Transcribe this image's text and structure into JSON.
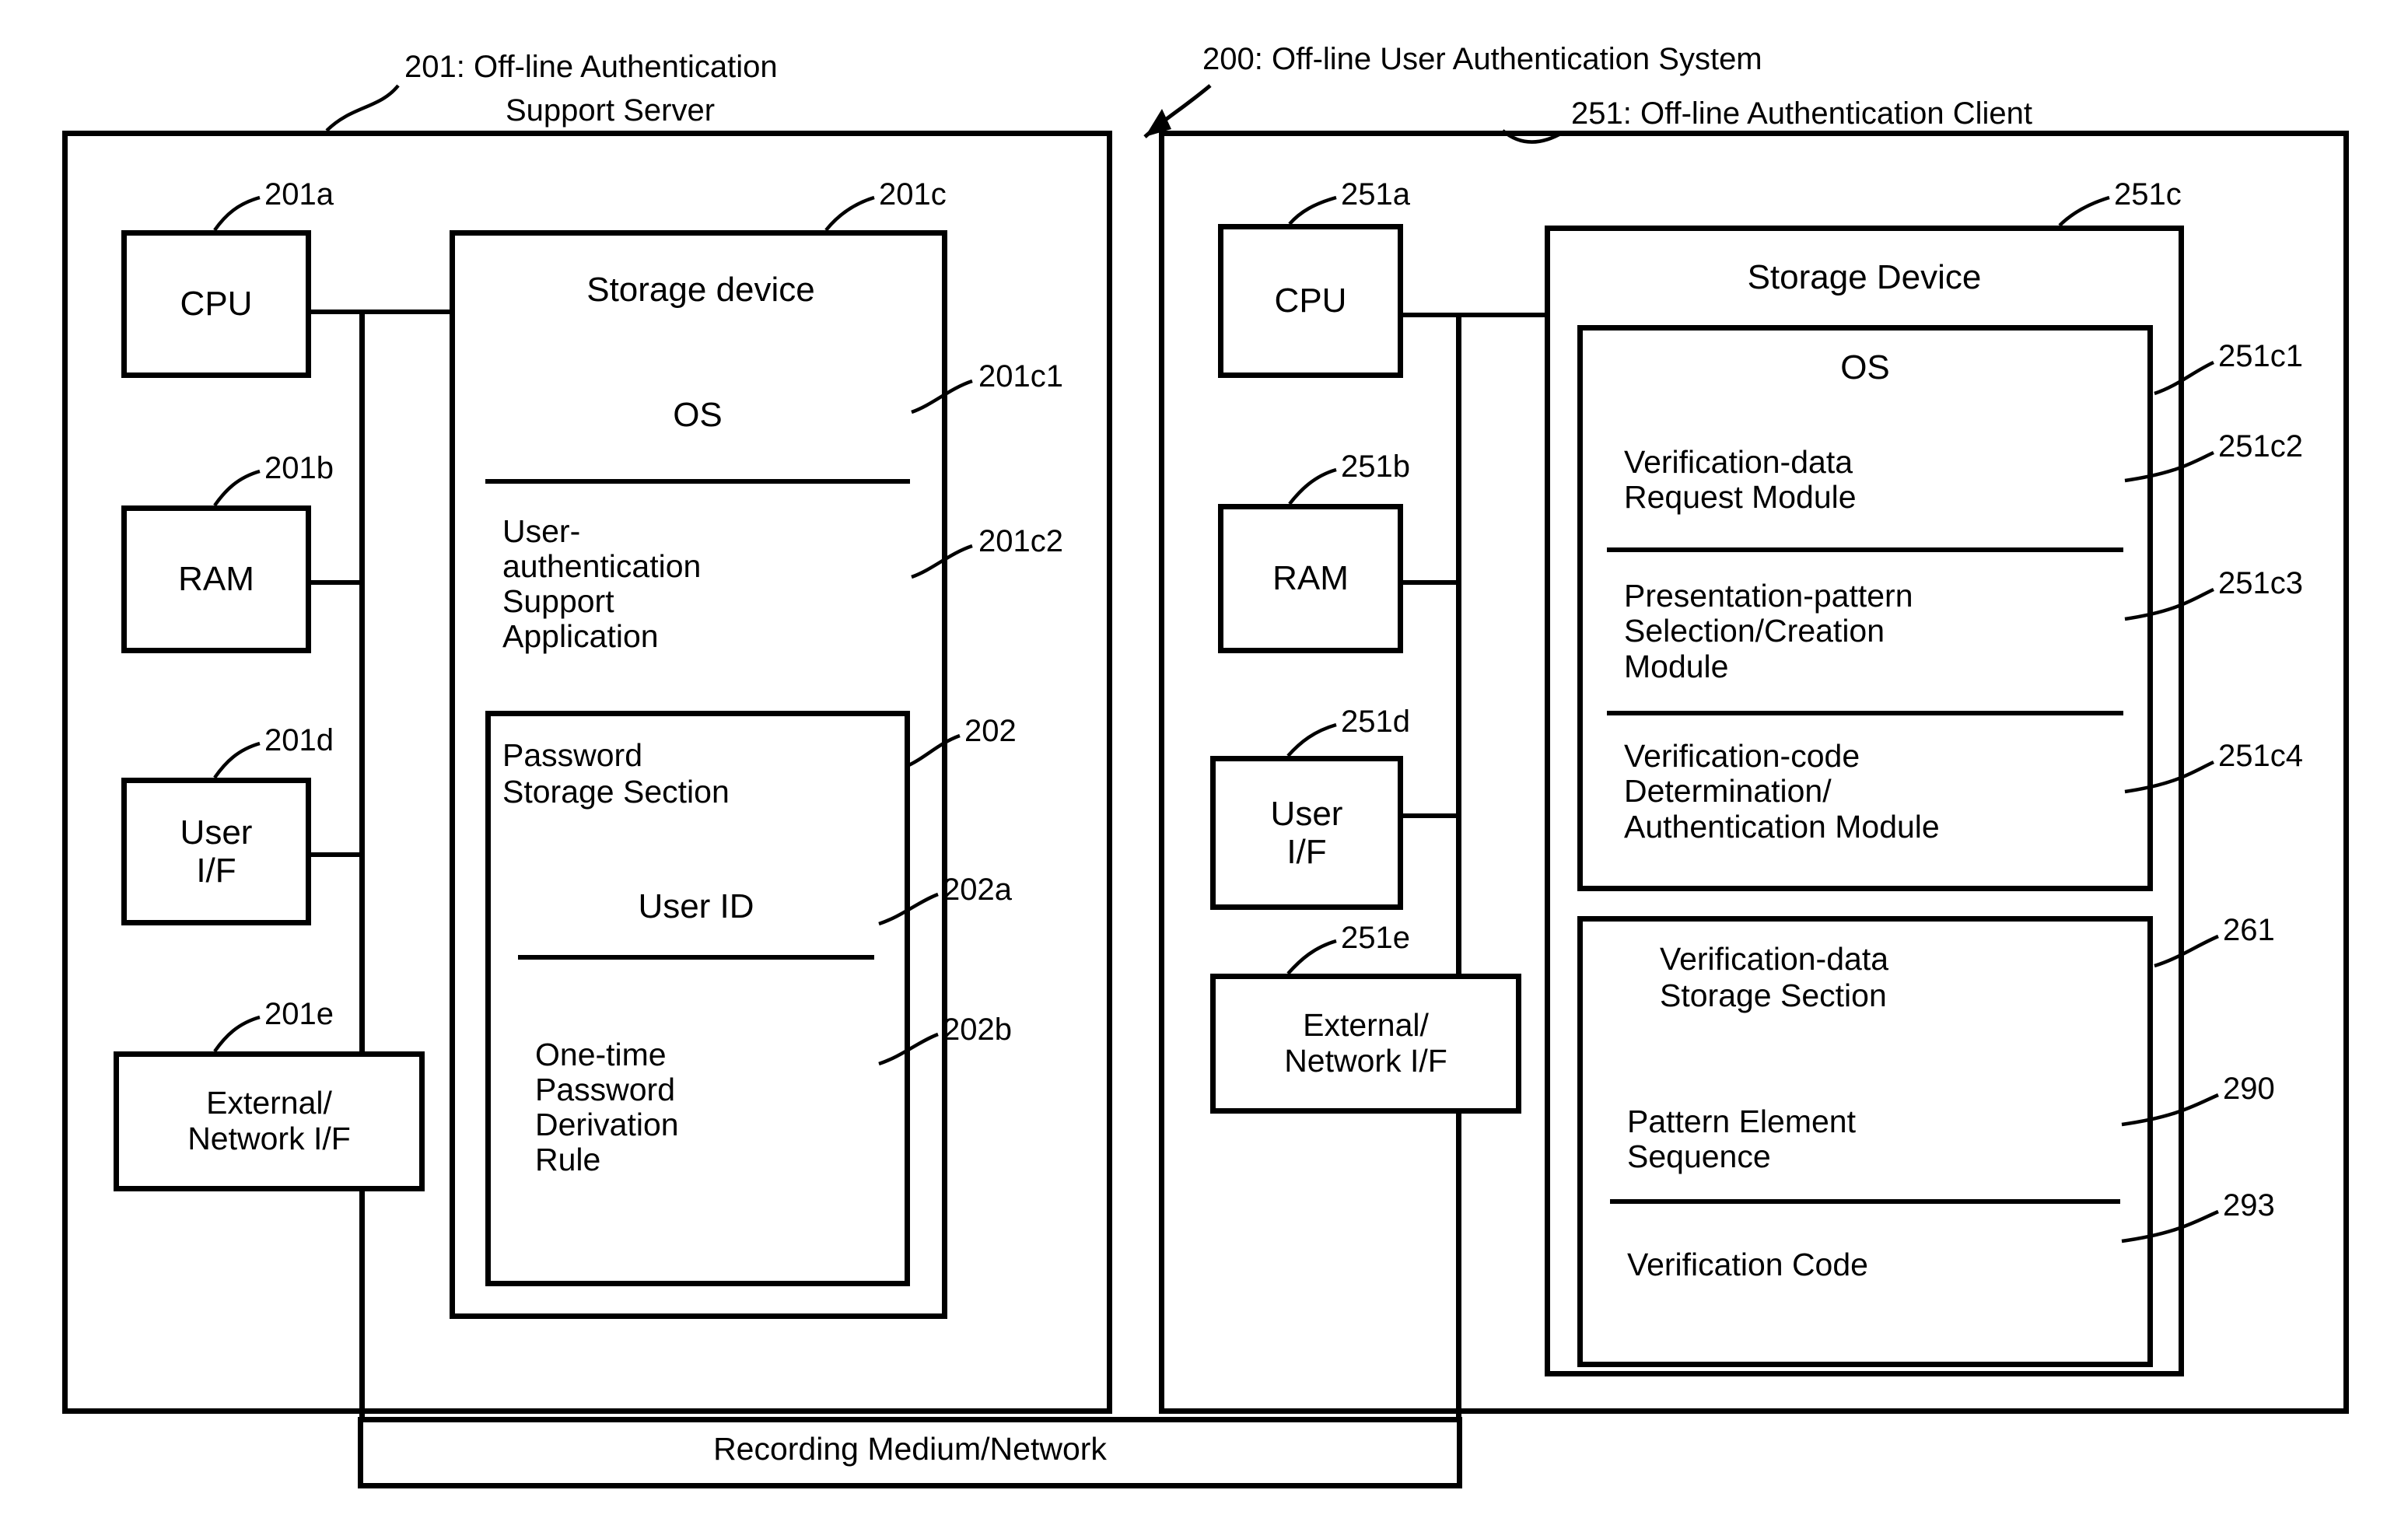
{
  "figure": {
    "system_title": "200: Off-line User Authentication System",
    "server_title_line1": "201: Off-line Authentication",
    "server_title_line2": "Support Server",
    "client_title": "251: Off-line Authentication Client",
    "bus_label": "Recording Medium/Network"
  },
  "server": {
    "ref": "201",
    "components": [
      {
        "ref": "201a",
        "label": "CPU"
      },
      {
        "ref": "201b",
        "label": "RAM"
      },
      {
        "ref": "201d",
        "label": "User\nI/F"
      },
      {
        "ref": "201e",
        "label": "External/\nNetwork I/F"
      }
    ],
    "storage": {
      "ref": "201c",
      "label": "Storage device",
      "modules": [
        {
          "ref": "201c1",
          "label": "OS"
        },
        {
          "ref": "201c2",
          "label": "User-\nauthentication\nSupport\nApplication"
        }
      ],
      "password_storage": {
        "ref": "202",
        "label": "Password\nStorage Section",
        "items": [
          {
            "ref": "202a",
            "label": "User ID"
          },
          {
            "ref": "202b",
            "label": "One-time\nPassword\nDerivation\nRule"
          }
        ]
      }
    }
  },
  "client": {
    "ref": "251",
    "components": [
      {
        "ref": "251a",
        "label": "CPU"
      },
      {
        "ref": "251b",
        "label": "RAM"
      },
      {
        "ref": "251d",
        "label": "User\nI/F"
      },
      {
        "ref": "251e",
        "label": "External/\nNetwork I/F"
      }
    ],
    "storage": {
      "ref": "251c",
      "label": "Storage Device",
      "os": {
        "ref": "251c1",
        "label": "OS",
        "modules": [
          {
            "ref": "251c2",
            "label": "Verification-data\nRequest Module"
          },
          {
            "ref": "251c3",
            "label": "Presentation-pattern\nSelection/Creation\nModule"
          },
          {
            "ref": "251c4",
            "label": "Verification-code\nDetermination/\nAuthentication Module"
          }
        ]
      },
      "verification_storage": {
        "ref": "261",
        "label": "Verification-data\nStorage Section",
        "items": [
          {
            "ref": "290",
            "label": "Pattern Element\nSequence"
          },
          {
            "ref": "293",
            "label": "Verification Code"
          }
        ]
      }
    }
  }
}
